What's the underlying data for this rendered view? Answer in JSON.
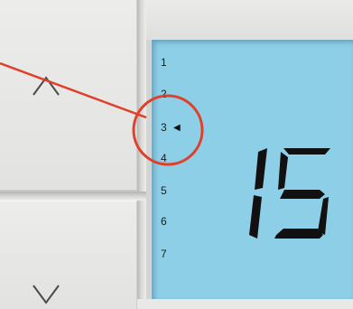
{
  "levels": [
    "1",
    "2",
    "3",
    "4",
    "5",
    "6",
    "7"
  ],
  "selected_marker": "◀",
  "display_value": "15",
  "colors": {
    "lcd_background": "#8ecfe8",
    "segment": "#111111",
    "annotation": "#e0402a"
  },
  "icons": {
    "up": "chevron-up-icon",
    "down": "chevron-down-icon"
  }
}
